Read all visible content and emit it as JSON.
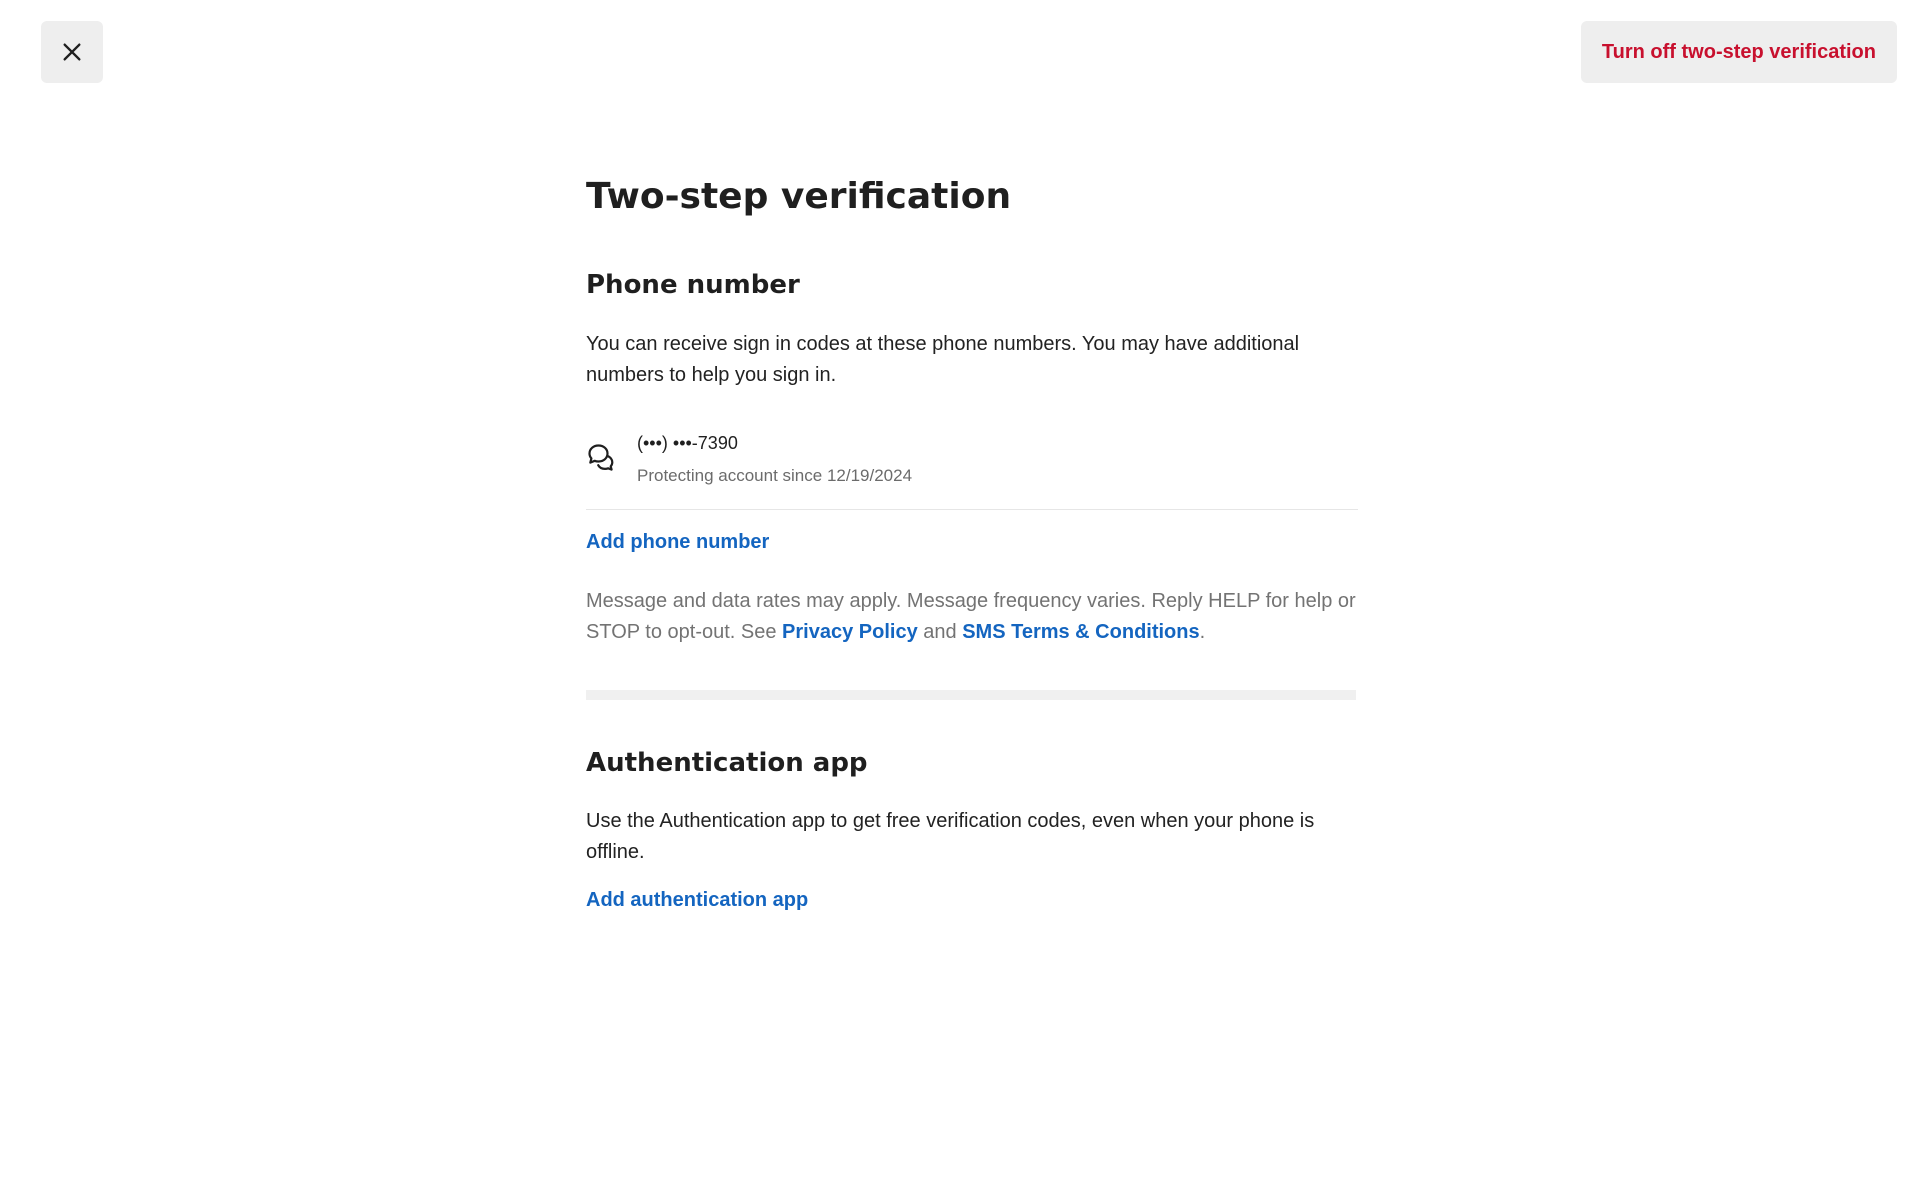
{
  "header": {
    "close_icon": "close-icon",
    "turn_off_label": "Turn off two-step verification",
    "turn_off_color": "#c8102e"
  },
  "page": {
    "title": "Two-step verification"
  },
  "phone_section": {
    "heading": "Phone number",
    "description": "You can receive sign in codes at these phone numbers. You may have additional numbers to help you sign in.",
    "entries": [
      {
        "icon": "chat-bubbles-icon",
        "number": "(•••) •••-7390",
        "since": "Protecting account since 12/19/2024"
      }
    ],
    "add_label": "Add phone number",
    "disclaimer_prefix": "Message and data rates may apply. Message frequency varies. Reply HELP for help or STOP to opt-out. See ",
    "privacy_link": "Privacy Policy",
    "disclaimer_and": " and ",
    "sms_terms_link": "SMS Terms & Conditions",
    "disclaimer_suffix": "."
  },
  "auth_section": {
    "heading": "Authentication app",
    "description": "Use the Authentication app to get free verification codes, even when your phone is offline.",
    "add_label": "Add authentication app"
  },
  "colors": {
    "link": "#1465c0",
    "danger": "#c8102e",
    "button_bg": "#eeeeee"
  }
}
